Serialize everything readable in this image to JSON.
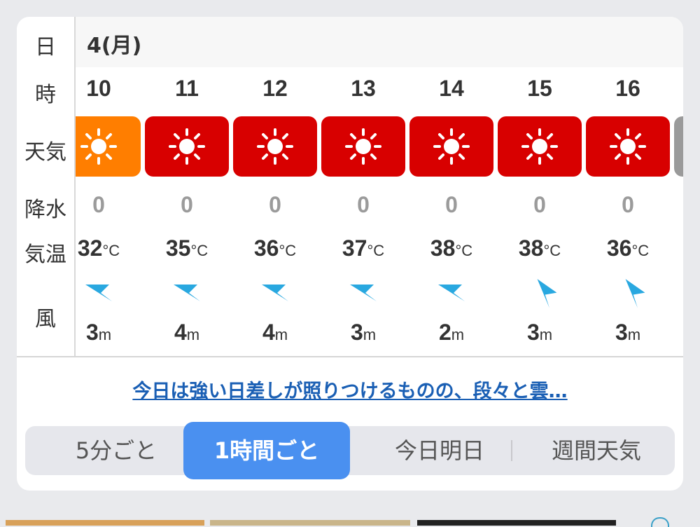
{
  "labels": {
    "day": "日",
    "hour": "時",
    "weather": "天気",
    "precip": "降水",
    "temp": "気温",
    "wind": "風"
  },
  "date": "4(月)",
  "units": {
    "temp": "°C",
    "wind": "m"
  },
  "hours": [
    {
      "hour": "10",
      "weather": "sunny",
      "tile_color": "#ff7e00",
      "precip": "0",
      "temp": "32",
      "wind_speed": "3",
      "wind_icon": "wind-arrow-southwest"
    },
    {
      "hour": "11",
      "weather": "sunny",
      "tile_color": "#d80000",
      "precip": "0",
      "temp": "35",
      "wind_speed": "4",
      "wind_icon": "wind-arrow-southwest"
    },
    {
      "hour": "12",
      "weather": "sunny",
      "tile_color": "#d80000",
      "precip": "0",
      "temp": "36",
      "wind_speed": "4",
      "wind_icon": "wind-arrow-southwest"
    },
    {
      "hour": "13",
      "weather": "sunny",
      "tile_color": "#d80000",
      "precip": "0",
      "temp": "37",
      "wind_speed": "3",
      "wind_icon": "wind-arrow-southwest"
    },
    {
      "hour": "14",
      "weather": "sunny",
      "tile_color": "#d80000",
      "precip": "0",
      "temp": "38",
      "wind_speed": "2",
      "wind_icon": "wind-arrow-southwest"
    },
    {
      "hour": "15",
      "weather": "sunny",
      "tile_color": "#d80000",
      "precip": "0",
      "temp": "38",
      "wind_speed": "3",
      "wind_icon": "wind-arrow-south"
    },
    {
      "hour": "16",
      "weather": "sunny",
      "tile_color": "#d80000",
      "precip": "0",
      "temp": "36",
      "wind_speed": "3",
      "wind_icon": "wind-arrow-south"
    }
  ],
  "summary_link": "今日は強い日差しが照りつけるものの、段々と雲…",
  "tabs": [
    {
      "label": "5分ごと",
      "active": false
    },
    {
      "label": "1時間ごと",
      "active": true
    },
    {
      "label": "今日明日",
      "active": false
    },
    {
      "label": "週間天気",
      "active": false
    }
  ],
  "colors": {
    "accent": "#4a90f0",
    "hot_tile": "#d80000",
    "warm_tile": "#ff7e00",
    "wind_arrow": "#29a8e0",
    "link": "#1a5fb4"
  }
}
